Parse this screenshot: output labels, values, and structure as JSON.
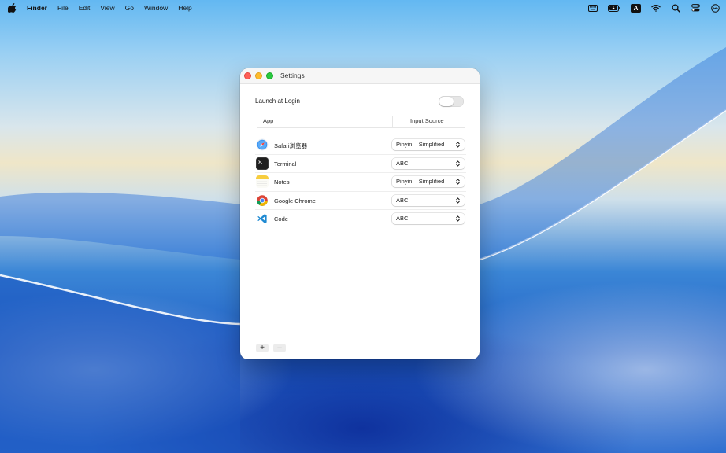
{
  "menubar": {
    "apple_icon": "apple-logo-icon",
    "items": [
      "Finder",
      "File",
      "Edit",
      "View",
      "Go",
      "Window",
      "Help"
    ],
    "status_icons": [
      "keyboard-icon",
      "battery-icon",
      "input-source-icon",
      "wifi-icon",
      "search-icon",
      "control-center-icon",
      "siri-icon"
    ],
    "input_source_badge": "A"
  },
  "window": {
    "title": "Settings",
    "launch_label": "Launch at Login",
    "launch_enabled": false,
    "table": {
      "col_app": "App",
      "col_source": "Input Source",
      "rows": [
        {
          "app": "Safari浏览器",
          "icon": "safari-icon",
          "source": "Pinyin – Simplified"
        },
        {
          "app": "Terminal",
          "icon": "terminal-icon",
          "source": "ABC"
        },
        {
          "app": "Notes",
          "icon": "notes-icon",
          "source": "Pinyin – Simplified"
        },
        {
          "app": "Google Chrome",
          "icon": "chrome-icon",
          "source": "ABC"
        },
        {
          "app": "Code",
          "icon": "vscode-icon",
          "source": "ABC"
        }
      ]
    },
    "add_label": "+",
    "remove_label": "–"
  }
}
